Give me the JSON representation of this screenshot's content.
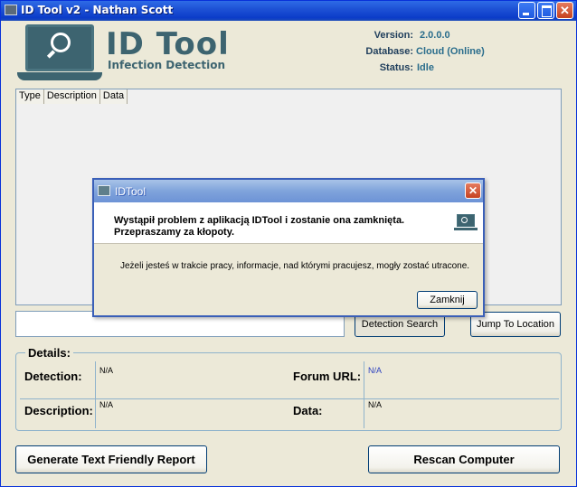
{
  "window": {
    "title": "ID Tool v2 - Nathan Scott",
    "controls": {
      "minimize": "",
      "maximize": "",
      "close": "✕"
    }
  },
  "logo": {
    "title": "ID Tool",
    "subtitle": "Infection Detection",
    "icon": "laptop-magnifier-icon"
  },
  "info": {
    "version_label": "Version:",
    "version_value": "2.0.0.0",
    "database_label": "Database:",
    "database_value": "Cloud (Online)",
    "status_label": "Status:",
    "status_value": "Idle"
  },
  "list": {
    "columns": [
      "Type",
      "Description",
      "Data"
    ]
  },
  "search": {
    "value": "",
    "detection_search_label": "Detection Search",
    "jump_label": "Jump To Location"
  },
  "details": {
    "legend": "Details:",
    "detection_label": "Detection:",
    "detection_value": "N/A",
    "forum_label": "Forum URL:",
    "forum_value": "N/A",
    "description_label": "Description:",
    "description_value": "N/A",
    "data_label": "Data:",
    "data_value": "N/A"
  },
  "actions": {
    "report_label": "Generate Text Friendly Report",
    "rescan_label": "Rescan Computer"
  },
  "dialog": {
    "title": "IDTool",
    "close": "✕",
    "message_line1": "Wystąpił problem z aplikacją IDTool i zostanie ona zamknięta.",
    "message_line2": "Przepraszamy za kłopoty.",
    "info": "Jeżeli jesteś w trakcie pracy, informacje, nad którymi pracujesz, mogły zostać utracone.",
    "button_label": "Zamknij"
  },
  "colors": {
    "titlebar": "#0B3CC9",
    "brand": "#3d6470",
    "value": "#2a6d8c",
    "link": "#2a3fbf"
  }
}
